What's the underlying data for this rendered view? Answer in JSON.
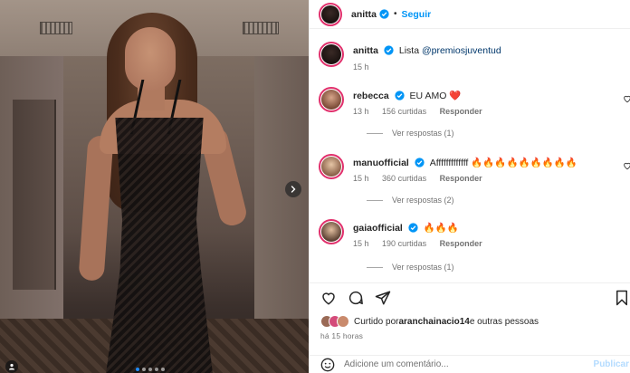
{
  "post": {
    "image_alt": "",
    "carousel_dots": 5,
    "carousel_active": 0
  },
  "header": {
    "username": "anitta",
    "separator": "•",
    "follow_label": "Seguir"
  },
  "caption": {
    "username": "anitta",
    "text": "Lista ",
    "mention": "@premiosjuventud",
    "time": "15 h"
  },
  "comments": [
    {
      "username": "rebecca",
      "text": "EU AMO ❤️",
      "time": "13 h",
      "likes": "156 curtidas",
      "reply_label": "Responder",
      "view_replies": "Ver respostas (1)"
    },
    {
      "username": "manuofficial",
      "text": "Afffffffffffff 🔥🔥🔥🔥🔥🔥🔥🔥🔥",
      "time": "15 h",
      "likes": "360 curtidas",
      "reply_label": "Responder",
      "view_replies": "Ver respostas (2)"
    },
    {
      "username": "gaiaofficial",
      "text": "🔥🔥🔥",
      "time": "15 h",
      "likes": "190 curtidas",
      "reply_label": "Responder",
      "view_replies": "Ver respostas (1)"
    }
  ],
  "liked_by": {
    "prefix": "Curtido por ",
    "user": "aranchainacio14",
    "suffix": " e outras pessoas"
  },
  "posted_ago": "há 15 horas",
  "add_comment": {
    "placeholder": "Adicione um comentário...",
    "publish_label": "Publicar"
  },
  "colors": {
    "accent": "#0095f6",
    "story_ring": "#e1306c",
    "verified": "#0095f6",
    "heart": "#ed4956"
  },
  "icons": [
    "heart-icon",
    "comment-icon",
    "share-icon",
    "bookmark-icon",
    "verified-badge-icon",
    "chevron-right-icon",
    "emoji-icon",
    "user-tag-icon"
  ]
}
